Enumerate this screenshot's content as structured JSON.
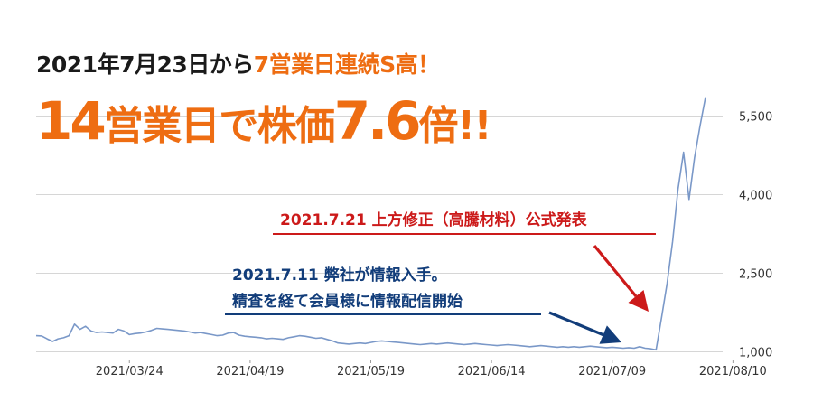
{
  "headline": {
    "line1_a": "2021年7月23日から",
    "line1_b": "7営業日連続S高！",
    "line2_a": "14",
    "line2_b": "営業日で株価",
    "line2_c": "7.6",
    "line2_d": "倍!!"
  },
  "annotations": {
    "disclosure": "2021.7.21 上方修正（高騰材料）公式発表",
    "info_line1": "2021.7.11 弊社が情報入手。",
    "info_line2": "精査を経て会員様に情報配信開始"
  },
  "colors": {
    "accent": "#ee6d12",
    "series": "#7a98c8",
    "grid": "#d6d6d6",
    "annotation_red": "#cc1a1a",
    "annotation_blue": "#123d7a",
    "tick_text": "#333333"
  },
  "chart_data": {
    "type": "line",
    "title": "",
    "xlabel": "",
    "ylabel": "",
    "ylim": [
      800,
      6000
    ],
    "grid": "horizontal",
    "y_ticks": [
      1000,
      2500,
      4000,
      5500
    ],
    "y_tick_labels": [
      "1,000",
      "2,500",
      "4,000",
      "5,500"
    ],
    "x_tick_labels": [
      "2021/03/24",
      "2021/04/19",
      "2021/05/19",
      "2021/06/14",
      "2021/07/09",
      "2021/08/10"
    ],
    "x_tick_index": [
      17,
      39,
      61,
      83,
      105,
      127
    ],
    "series": [
      {
        "values": [
          1300,
          1295,
          1240,
          1190,
          1240,
          1260,
          1300,
          1520,
          1420,
          1480,
          1390,
          1360,
          1370,
          1360,
          1350,
          1420,
          1390,
          1320,
          1340,
          1350,
          1370,
          1400,
          1440,
          1430,
          1420,
          1410,
          1400,
          1390,
          1370,
          1350,
          1360,
          1340,
          1320,
          1300,
          1310,
          1350,
          1360,
          1310,
          1290,
          1280,
          1270,
          1260,
          1240,
          1250,
          1240,
          1230,
          1260,
          1280,
          1300,
          1290,
          1270,
          1250,
          1260,
          1230,
          1200,
          1160,
          1150,
          1140,
          1150,
          1160,
          1150,
          1170,
          1190,
          1200,
          1190,
          1180,
          1170,
          1160,
          1150,
          1140,
          1130,
          1140,
          1150,
          1140,
          1150,
          1160,
          1150,
          1140,
          1130,
          1140,
          1150,
          1140,
          1130,
          1120,
          1110,
          1120,
          1130,
          1120,
          1110,
          1100,
          1090,
          1100,
          1110,
          1100,
          1090,
          1080,
          1090,
          1080,
          1090,
          1080,
          1090,
          1100,
          1090,
          1080,
          1070,
          1080,
          1070,
          1060,
          1070,
          1060,
          1090,
          1060,
          1050,
          1030,
          1650,
          2300,
          3100,
          4100,
          4800,
          3900,
          4700,
          5300,
          5850
        ]
      }
    ]
  }
}
